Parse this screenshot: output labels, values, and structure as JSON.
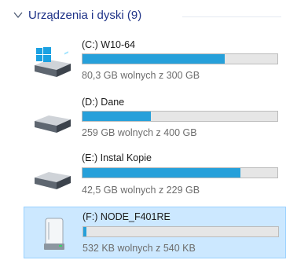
{
  "group": {
    "title": "Urządzenia i dyski (9)",
    "icon": "chevron-down-icon"
  },
  "drives": [
    {
      "name": "(C:) W10-64",
      "free_text": "80,3 GB wolnych z 300 GB",
      "used_fraction": 0.73,
      "icon": "system-drive-icon",
      "selected": false
    },
    {
      "name": "(D:) Dane",
      "free_text": "259 GB wolnych z 400 GB",
      "used_fraction": 0.35,
      "icon": "hard-drive-icon",
      "selected": false
    },
    {
      "name": "(E:) Instal Kopie",
      "free_text": "42,5 GB wolnych z 229 GB",
      "used_fraction": 0.81,
      "icon": "hard-drive-icon",
      "selected": false
    },
    {
      "name": "(F:) NODE_F401RE",
      "free_text": "532 KB wolnych z 540 KB",
      "used_fraction": 0.015,
      "icon": "removable-drive-icon",
      "selected": true
    }
  ],
  "colors": {
    "accent": "#26a0da",
    "selection": "#cce8ff",
    "header_text": "#1e3287"
  }
}
